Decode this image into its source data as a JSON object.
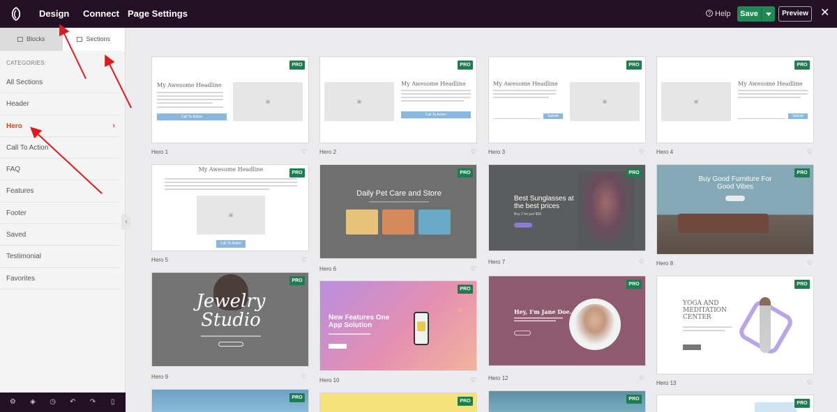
{
  "topbar": {
    "nav": [
      "Design",
      "Connect",
      "Page Settings"
    ],
    "help": "Help",
    "save": "Save",
    "preview": "Preview",
    "close": "✕"
  },
  "sidebar": {
    "tabs": [
      "Blocks",
      "Sections"
    ],
    "categories_label": "CATEGORIES:",
    "categories": [
      "All Sections",
      "Header",
      "Hero",
      "Call To Action",
      "FAQ",
      "Features",
      "Footer",
      "Saved",
      "Testimonial",
      "Favorites"
    ],
    "active_category": "Hero"
  },
  "cards": {
    "pro": "PRO",
    "captions": [
      "Hero 1",
      "Hero 2",
      "Hero 3",
      "Hero 4",
      "Hero 5",
      "Hero 6",
      "Hero 7",
      "Hero 8",
      "Hero 9",
      "Hero 10",
      "Hero 12",
      "Hero 13"
    ],
    "headline": "My Awesome Headline",
    "cta": "Call To Action",
    "submit": "Submit",
    "pet_title": "Daily Pet Care and Store",
    "sunglasses_title": "Best Sunglasses at the best prices",
    "sunglasses_sub": "Buy 2 for just $99",
    "furniture_title": "Buy Good Furniture For Good Vibes",
    "jewelry_title": "Jewelry Studio",
    "app_title": "New Features One App Solution",
    "jane_title": "Hey, I'm Jane Doe.",
    "yoga_title": "YOGA AND MEDITATION CENTER"
  },
  "colors": {
    "topbar": "#241025",
    "accent_active": "#d04a1a",
    "save": "#1f8a53",
    "pro_badge": "#1e7d4f",
    "annotation_arrow": "#e0191e"
  }
}
